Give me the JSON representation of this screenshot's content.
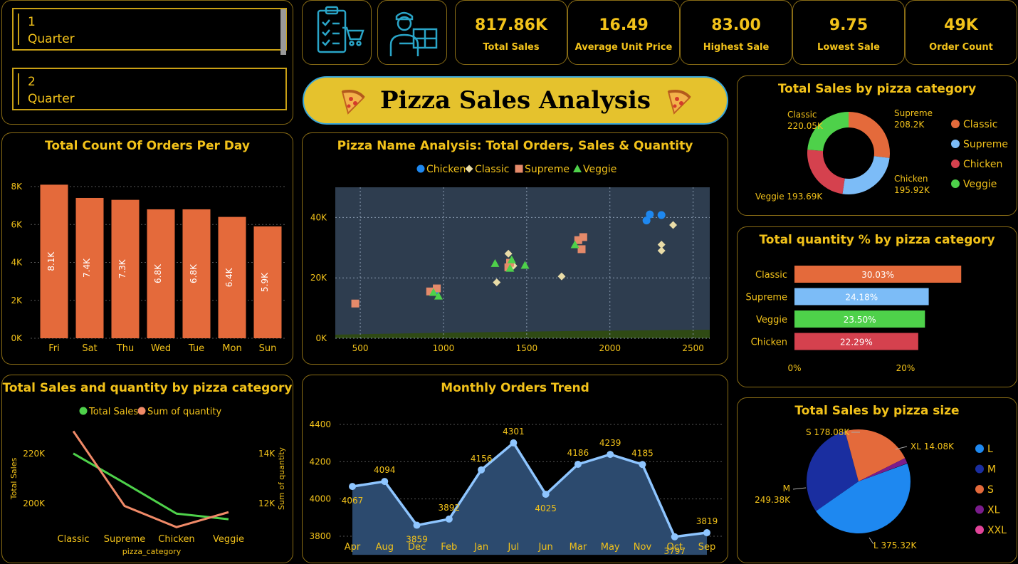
{
  "slicers": [
    {
      "number": "1",
      "label": "Quarter"
    },
    {
      "number": "2",
      "label": "Quarter"
    }
  ],
  "icons": [
    "clipboard-cart-icon",
    "delivery-person-icon",
    "pizza-slice-icon"
  ],
  "kpis": [
    {
      "value": "817.86K",
      "label": "Total Sales"
    },
    {
      "value": "16.49",
      "label": "Average Unit Price"
    },
    {
      "value": "83.00",
      "label": "Highest Sale"
    },
    {
      "value": "9.75",
      "label": "Lowest Sale"
    },
    {
      "value": "49K",
      "label": "Order Count"
    }
  ],
  "banner": {
    "title": "Pizza Sales Analysis"
  },
  "colors": {
    "accent": "#f2c21a",
    "orange": "#e46a3b",
    "blue": "#7cbcf7",
    "red": "#d5414e",
    "green": "#4ed14a",
    "navy": "#1a2ea0",
    "purple": "#7b1c8c",
    "pink": "#e2449a",
    "scatter_bg": "#2e3d4f"
  },
  "chart_data": [
    {
      "id": "orders_per_day",
      "type": "bar",
      "title": "Total Count Of Orders Per Day",
      "categories": [
        "Fri",
        "Sat",
        "Thu",
        "Wed",
        "Tue",
        "Mon",
        "Sun"
      ],
      "values": [
        8100,
        7400,
        7300,
        6800,
        6800,
        6400,
        5900
      ],
      "data_labels": [
        "8.1K",
        "7.4K",
        "7.3K",
        "6.8K",
        "6.8K",
        "6.4K",
        "5.9K"
      ],
      "ylim": [
        0,
        8000
      ],
      "yticks": [
        0,
        2000,
        4000,
        6000,
        8000
      ],
      "ytick_labels": [
        "0K",
        "2K",
        "4K",
        "6K",
        "8K"
      ]
    },
    {
      "id": "pizza_name_scatter",
      "type": "scatter",
      "title": "Pizza Name Analysis: Total Orders, Sales & Quantity",
      "xlim": [
        350,
        2600
      ],
      "ylim": [
        0,
        50000
      ],
      "xticks": [
        500,
        1000,
        1500,
        2000,
        2500
      ],
      "xtick_labels": [
        "500",
        "1000",
        "1500",
        "2000",
        "2500"
      ],
      "yticks": [
        0,
        20000,
        40000
      ],
      "ytick_labels": [
        "0K",
        "20K",
        "40K"
      ],
      "series": [
        {
          "name": "Chicken",
          "marker": "circle",
          "points": [
            [
              2240,
              41000
            ],
            [
              2310,
              40800
            ],
            [
              2220,
              39000
            ],
            [
              960,
              16200
            ],
            [
              950,
              15800
            ]
          ]
        },
        {
          "name": "Classic",
          "marker": "diamond",
          "points": [
            [
              2380,
              37500
            ],
            [
              2310,
              31000
            ],
            [
              2310,
              29000
            ],
            [
              1390,
              28000
            ],
            [
              1420,
              24000
            ],
            [
              1710,
              20500
            ],
            [
              1320,
              18500
            ],
            [
              930,
              15500
            ]
          ]
        },
        {
          "name": "Supreme",
          "marker": "square",
          "points": [
            [
              1840,
              33500
            ],
            [
              1810,
              32500
            ],
            [
              1830,
              29500
            ],
            [
              1400,
              25000
            ],
            [
              1390,
              23500
            ],
            [
              920,
              15500
            ],
            [
              960,
              16500
            ],
            [
              470,
              11500
            ]
          ]
        },
        {
          "name": "Veggie",
          "marker": "triangle",
          "points": [
            [
              1790,
              31000
            ],
            [
              1410,
              26000
            ],
            [
              1310,
              24800
            ],
            [
              1490,
              24200
            ],
            [
              1400,
              23200
            ],
            [
              940,
              15200
            ],
            [
              970,
              14000
            ]
          ]
        }
      ]
    },
    {
      "id": "sales_by_category",
      "type": "pie",
      "title": "Total Sales by pizza category",
      "categories": [
        "Classic",
        "Supreme",
        "Chicken",
        "Veggie"
      ],
      "values": [
        220.05,
        208.2,
        195.92,
        193.69
      ],
      "data_labels": [
        "220.05K",
        "208.2K",
        "195.92K",
        "193.69K"
      ]
    },
    {
      "id": "qty_pct_by_category",
      "type": "bar",
      "title": "Total quantity % by pizza category",
      "categories": [
        "Classic",
        "Supreme",
        "Veggie",
        "Chicken"
      ],
      "values": [
        30.03,
        24.18,
        23.5,
        22.29
      ],
      "data_labels": [
        "30.03%",
        "24.18%",
        "23.50%",
        "22.29%"
      ],
      "xticks": [
        0,
        20
      ],
      "xtick_labels": [
        "0%",
        "20%"
      ]
    },
    {
      "id": "sales_qty_by_category",
      "type": "line",
      "title": "Total Sales and quantity by pizza category",
      "categories": [
        "Classic",
        "Supreme",
        "Chicken",
        "Veggie"
      ],
      "xlabel": "pizza_category",
      "ylabel": "Total Sales",
      "y2label": "Sum of quantity",
      "series": [
        {
          "name": "Total Sales",
          "axis": "left",
          "values": [
            220050,
            208200,
            195920,
            193690
          ]
        },
        {
          "name": "Sum of quantity",
          "axis": "right",
          "values": [
            14900,
            11900,
            11050,
            11650
          ]
        }
      ],
      "left_ticks": [
        200000,
        220000
      ],
      "left_tick_labels": [
        "200K",
        "220K"
      ],
      "right_ticks": [
        12000,
        14000
      ],
      "right_tick_labels": [
        "12K",
        "14K"
      ]
    },
    {
      "id": "monthly_orders",
      "type": "area",
      "title": "Monthly Orders Trend",
      "categories": [
        "Apr",
        "Aug",
        "Dec",
        "Feb",
        "Jan",
        "Jul",
        "Jun",
        "Mar",
        "May",
        "Nov",
        "Oct",
        "Sep"
      ],
      "values": [
        4067,
        4094,
        3859,
        3892,
        4156,
        4301,
        4025,
        4186,
        4239,
        4185,
        3797,
        3819
      ],
      "ylim": [
        3700,
        4400
      ],
      "yticks": [
        3800,
        4000,
        4200,
        4400
      ]
    },
    {
      "id": "sales_by_size",
      "type": "pie",
      "title": "Total Sales by pizza size",
      "categories": [
        "L",
        "M",
        "S",
        "XL",
        "XXL"
      ],
      "values": [
        375.32,
        249.38,
        178.08,
        14.08,
        1.0
      ],
      "data_labels": [
        "L 375.32K",
        "M\n249.38K",
        "S 178.08K",
        "XL 14.08K",
        ""
      ]
    }
  ]
}
